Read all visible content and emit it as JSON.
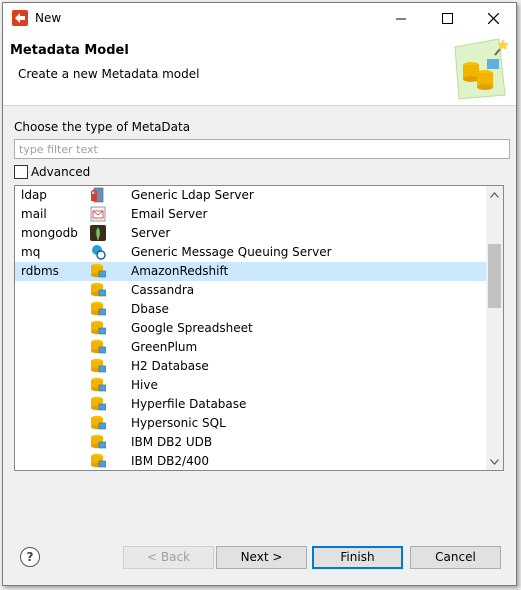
{
  "window": {
    "title": "New"
  },
  "header": {
    "title": "Metadata Model",
    "description": "Create a new Metadata model"
  },
  "form": {
    "choose_label": "Choose the type of MetaData",
    "filter_placeholder": "type filter text",
    "filter_value": "",
    "advanced_label": "Advanced",
    "advanced_checked": false
  },
  "list": {
    "rows": [
      {
        "category": "ldap",
        "name": "Generic Ldap Server",
        "icon": "ldap-server-icon"
      },
      {
        "category": "mail",
        "name": "Email Server",
        "icon": "email-server-icon"
      },
      {
        "category": "mongodb",
        "name": "Server",
        "icon": "mongodb-leaf-icon"
      },
      {
        "category": "mq",
        "name": "Generic Message Queuing Server",
        "icon": "mq-server-icon"
      },
      {
        "category": "rdbms",
        "name": "AmazonRedshift",
        "icon": "database-icon",
        "selected": true
      },
      {
        "category": "",
        "name": "Cassandra",
        "icon": "database-icon"
      },
      {
        "category": "",
        "name": "Dbase",
        "icon": "database-icon"
      },
      {
        "category": "",
        "name": "Google Spreadsheet",
        "icon": "database-icon"
      },
      {
        "category": "",
        "name": "GreenPlum",
        "icon": "database-icon"
      },
      {
        "category": "",
        "name": "H2 Database",
        "icon": "database-icon"
      },
      {
        "category": "",
        "name": "Hive",
        "icon": "database-icon"
      },
      {
        "category": "",
        "name": "Hyperfile Database",
        "icon": "database-icon"
      },
      {
        "category": "",
        "name": "Hypersonic SQL",
        "icon": "database-icon"
      },
      {
        "category": "",
        "name": "IBM DB2 UDB",
        "icon": "database-icon"
      },
      {
        "category": "",
        "name": "IBM DB2/400",
        "icon": "database-icon"
      }
    ]
  },
  "buttons": {
    "back": "< Back",
    "next": "Next >",
    "finish": "Finish",
    "cancel": "Cancel"
  },
  "colors": {
    "selection": "#cce8ff",
    "default_button_border": "#0078d7",
    "app_icon": "#d9411e"
  }
}
